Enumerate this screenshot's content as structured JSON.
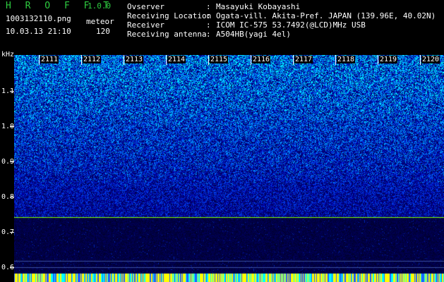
{
  "header": {
    "app_name": "H R O F F T",
    "version": "1.0.0",
    "filename": "1003132110.png",
    "mode": "meteor",
    "datetime": "10.03.13 21:10",
    "count": "120"
  },
  "meta": [
    {
      "key": "Ovserver",
      "value": "Masayuki Kobayashi"
    },
    {
      "key": "Receiving Location",
      "value": "Ogata-vill. Akita-Pref. JAPAN (139.96E, 40.02N)"
    },
    {
      "key": "Receiver",
      "value": "ICOM IC-575 53.7492(@LCD)MHz USB"
    },
    {
      "key": "Receiving antenna",
      "value": "A504HB(yagi 4el)"
    }
  ],
  "axis": {
    "y_unit": "kHz",
    "y_labels": [
      "1.1",
      "1.0",
      "0.9",
      "0.8",
      "0.7",
      "0.6"
    ],
    "time_labels": [
      "2111",
      "2112",
      "2113",
      "2114",
      "2115",
      "2116",
      "2117",
      "2118",
      "2119",
      "2120"
    ]
  },
  "colors": {
    "background": "#000000",
    "logo_green": "#2ecc40",
    "spectro_low": "#00008b",
    "spectro_high": "#00ffff",
    "carrier_line": "#7fff00",
    "bottom_band": "#ffff00"
  }
}
